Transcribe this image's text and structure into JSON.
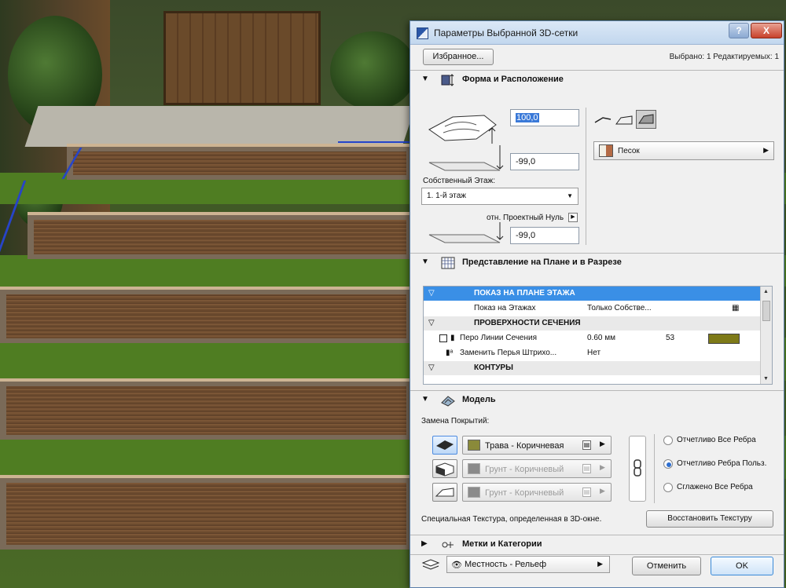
{
  "dialog": {
    "title": "Параметры Выбранной 3D-сетки",
    "help_label": "?",
    "close_label": "X",
    "favorites_label": "Избранное...",
    "selected_info": "Выбрано: 1 Редактируемых: 1"
  },
  "shape": {
    "section_title": "Форма и Расположение",
    "height_value": "100,0",
    "offset_value": "-99,0",
    "story_label": "Собственный Этаж:",
    "story_value": "1. 1-й этаж",
    "ref_label": "отн. Проектный Нуль",
    "ref_value": "-99,0",
    "material_value": "Песок"
  },
  "plan": {
    "section_title": "Представление на Плане и в Разрезе",
    "rows": [
      {
        "name": "ПОКАЗ НА ПЛАНЕ ЭТАЖА",
        "value": "",
        "extra": ""
      },
      {
        "name": "Показ на Этажах",
        "value": "Только Собстве...",
        "extra": ""
      },
      {
        "name": "ПРОВЕРХНОСТИ СЕЧЕНИЯ",
        "value": "",
        "extra": ""
      },
      {
        "name": "Перо Линии Сечения",
        "value": "0.60 мм",
        "extra": "53"
      },
      {
        "name": "Заменить Перья Штрихо...",
        "value": "Нет",
        "extra": ""
      },
      {
        "name": "КОНТУРЫ",
        "value": "",
        "extra": ""
      }
    ]
  },
  "model": {
    "section_title": "Модель",
    "override_label": "Замена Покрытий:",
    "materials": [
      "Трава - Коричневая",
      "Грунт - Коричневый",
      "Грунт - Коричневый"
    ],
    "edge_options": [
      "Отчетливо Все Ребра",
      "Отчетливо Ребра Польз.",
      "Сглажено Все Ребра"
    ],
    "texture_note": "Специальная Текстура, определенная в 3D-окне.",
    "restore_label": "Восстановить Текстуру"
  },
  "tags": {
    "section_title": "Метки и Категории"
  },
  "footer": {
    "layer_value": "Местность - Рельеф",
    "cancel_label": "Отменить",
    "ok_label": "OK"
  },
  "colors": {
    "selection_blue": "#3a8fe6",
    "pen_swatch": "#7e7a18",
    "grass_material": "#8a8a3a",
    "soil_material": "#8a8a8a"
  }
}
